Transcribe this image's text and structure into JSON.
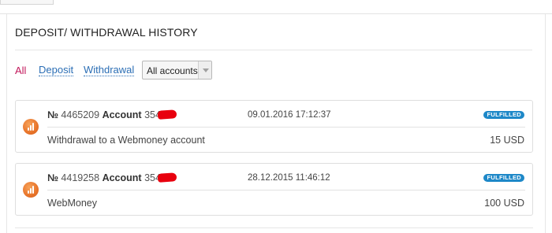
{
  "page": {
    "title": "DEPOSIT/ WITHDRAWAL HISTORY"
  },
  "filters": {
    "all": "All",
    "deposit": "Deposit",
    "withdrawal": "Withdrawal",
    "accounts_select": "All accounts"
  },
  "colors": {
    "active_filter": "#c2185b",
    "link": "#2b6eb5",
    "status_badge": "#1e88c8",
    "redaction": "#e8000e",
    "icon": "#e8742a"
  },
  "icons": {
    "transaction": "chart-bars-icon",
    "select_arrow": "chevron-down-icon"
  },
  "transactions": [
    {
      "number_prefix": "№",
      "number": "4465209",
      "account_label": "Account",
      "account": "354",
      "date": "09.01.2016 17:12:37",
      "status": "FULFILLED",
      "description": "Withdrawal to a Webmoney account",
      "amount": "15 USD"
    },
    {
      "number_prefix": "№",
      "number": "4419258",
      "account_label": "Account",
      "account": "354",
      "date": "28.12.2015 11:46:12",
      "status": "FULFILLED",
      "description": "WebMoney",
      "amount": "100 USD"
    }
  ]
}
